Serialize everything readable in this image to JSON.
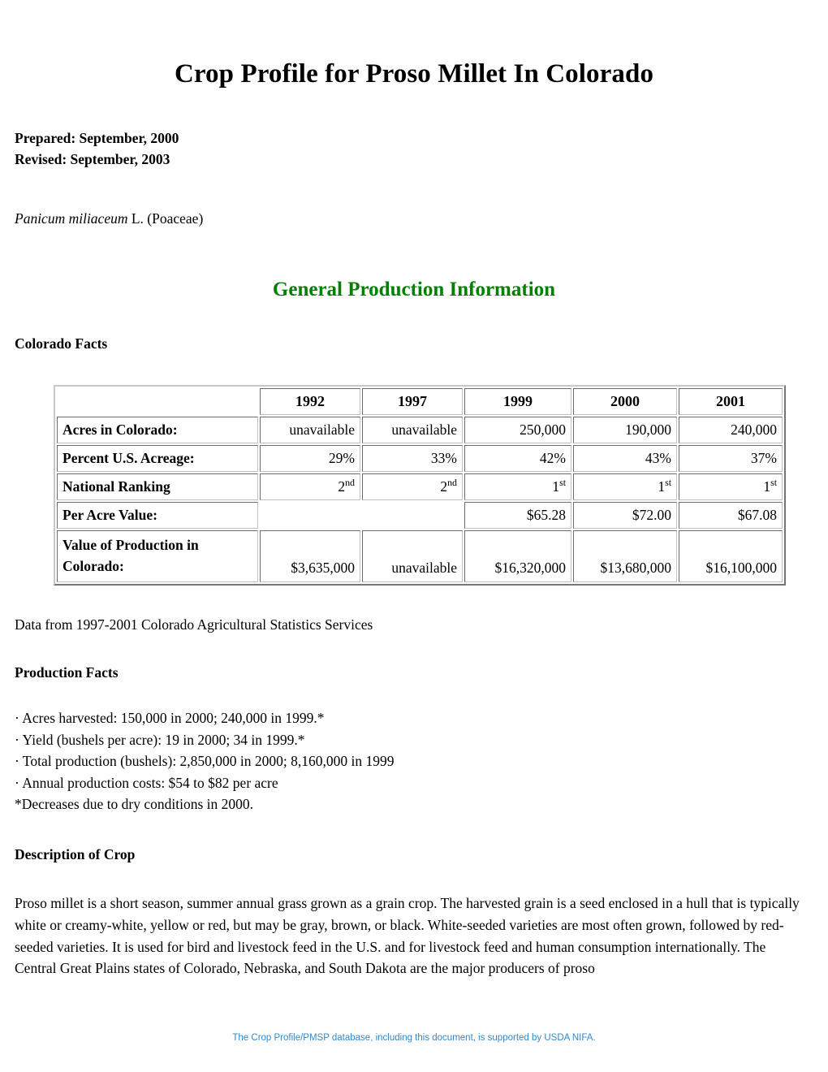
{
  "document": {
    "title": "Crop Profile for Proso Millet In Colorado",
    "prepared": "Prepared: September, 2000",
    "revised": "Revised: September, 2003",
    "species_italic": "Panicum miliaceum",
    "species_rest": " L. (Poaceae)"
  },
  "colors": {
    "heading_green": "#008000",
    "footer_blue": "#3389C8",
    "text_black": "#000000"
  },
  "general_production": {
    "heading": "General Production Information",
    "subheading": "Colorado Facts",
    "source_note": "Data from 1997-2001 Colorado Agricultural Statistics Services"
  },
  "facts_table": {
    "columns": [
      "",
      "1992",
      "1997",
      "1999",
      "2000",
      "2001"
    ],
    "rows": [
      {
        "label": "Acres in Colorado:",
        "values": [
          "unavailable",
          "unavailable",
          "250,000",
          "190,000",
          "240,000"
        ]
      },
      {
        "label": "Percent U.S. Acreage:",
        "values": [
          "29%",
          "33%",
          "42%",
          "43%",
          "37%"
        ]
      },
      {
        "label": "National Ranking",
        "values": [
          "2nd",
          "2nd",
          "1st",
          "1st",
          "1st"
        ],
        "ordinal": true,
        "ordinal_parts": [
          {
            "num": "2",
            "suf": "nd"
          },
          {
            "num": "2",
            "suf": "nd"
          },
          {
            "num": "1",
            "suf": "st"
          },
          {
            "num": "1",
            "suf": "st"
          },
          {
            "num": "1",
            "suf": "st"
          }
        ]
      },
      {
        "label": "Per Acre Value:",
        "values": [
          "",
          "",
          "$65.28",
          "$72.00",
          "$67.08"
        ],
        "empty_borderless": [
          0,
          1
        ]
      },
      {
        "label": "Value of Production in Colorado:",
        "values": [
          "$3,635,000",
          "unavailable",
          "$16,320,000",
          "$13,680,000",
          "$16,100,000"
        ],
        "tall": true
      }
    ]
  },
  "production_facts": {
    "heading": "Production Facts",
    "bullets": [
      "· Acres harvested: 150,000 in 2000; 240,000 in 1999.*",
      "· Yield (bushels per acre): 19 in 2000; 34 in 1999.*",
      "· Total production (bushels): 2,850,000 in 2000; 8,160,000 in 1999",
      "· Annual production costs: $54 to $82 per acre",
      "*Decreases due to dry conditions in 2000."
    ]
  },
  "description": {
    "heading": "Description of Crop",
    "body": "Proso millet is a short season, summer annual grass grown as a grain crop. The harvested grain is a seed enclosed in a hull that is typically white or creamy-white, yellow or red, but may be gray, brown, or black. White-seeded varieties are most often grown, followed by red-seeded varieties. It is used for bird and livestock feed in the U.S. and for livestock feed and human consumption internationally. The Central Great Plains states of Colorado, Nebraska, and South Dakota are the major producers of proso"
  },
  "footer": {
    "text": "The Crop Profile/PMSP database, including this document, is supported by USDA NIFA."
  }
}
